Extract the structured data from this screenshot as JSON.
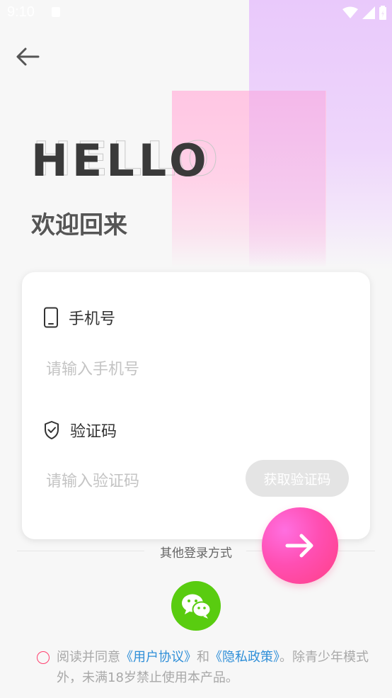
{
  "status_bar": {
    "time": "9:10"
  },
  "header": {
    "hello": "HELLO",
    "welcome": "欢迎回来"
  },
  "form": {
    "phone_label": "手机号",
    "phone_placeholder": "请输入手机号",
    "code_label": "验证码",
    "code_placeholder": "请输入验证码",
    "get_code_label": "获取验证码"
  },
  "other_login": {
    "label": "其他登录方式"
  },
  "agreement": {
    "prefix": "阅读并同意",
    "user_agreement": "《用户协议》",
    "and": "和",
    "privacy_policy": "《隐私政策》",
    "suffix": "。除青少年模式外，未满18岁禁止使用本产品。"
  },
  "icons": {
    "back": "arrow-left-icon",
    "phone": "mobile-phone-icon",
    "code": "shield-check-icon",
    "submit": "arrow-right-icon",
    "wechat": "wechat-icon",
    "wifi": "wifi-icon",
    "signal": "signal-icon",
    "battery": "battery-icon"
  },
  "colors": {
    "accent_pink": "#ff4fb3",
    "wechat_green": "#59cc10",
    "link_blue": "#2f8fd8",
    "radio_red": "#ff3f6e"
  }
}
